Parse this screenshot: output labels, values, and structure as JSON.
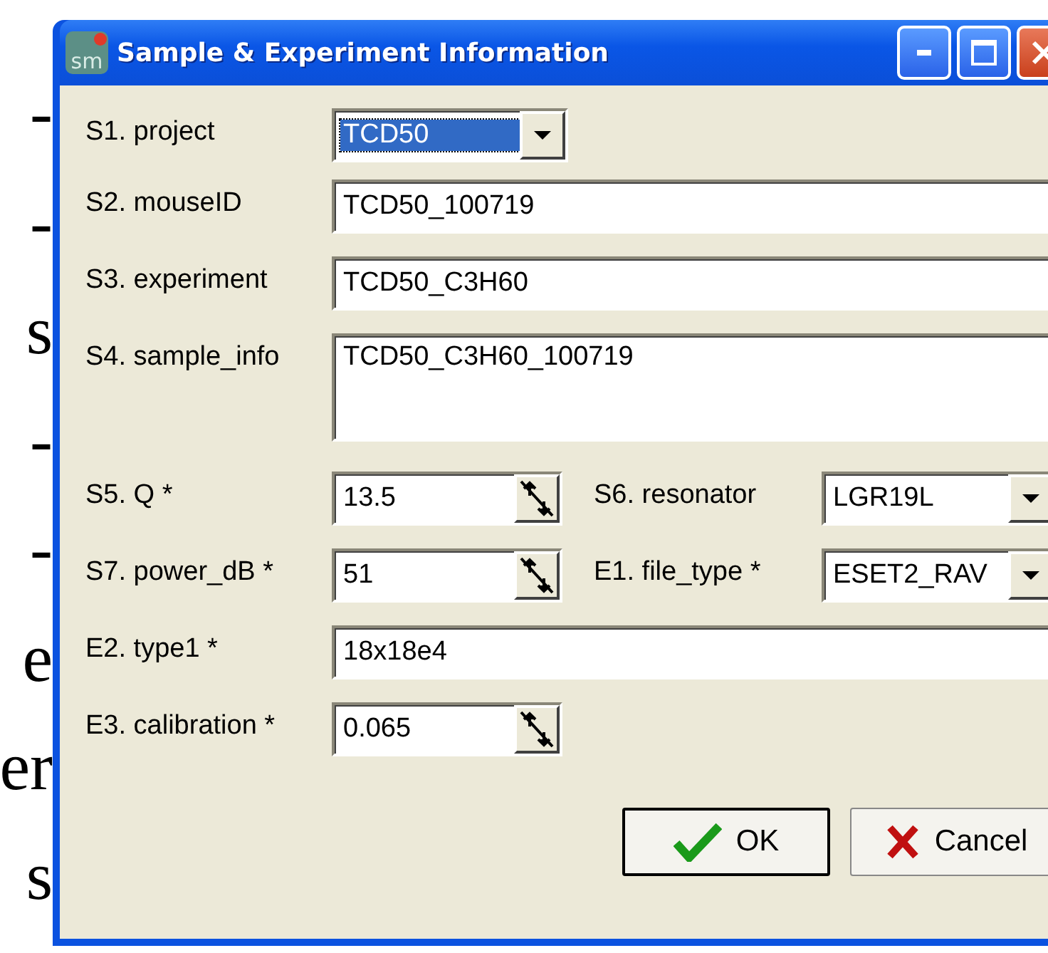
{
  "background_text": [
    "-",
    "-",
    "s",
    "-",
    "-",
    "e",
    "er",
    "s"
  ],
  "window": {
    "icon_text": "sm",
    "title": "Sample & Experiment Information",
    "controls": [
      {
        "kind": "minimize"
      },
      {
        "kind": "maximize"
      },
      {
        "kind": "close"
      }
    ]
  },
  "rows": [
    {
      "fields": [
        {
          "label": "S1. project",
          "kind": "combo",
          "value": "TCD50",
          "focused": true
        }
      ]
    },
    {
      "fields": [
        {
          "label": "S2. mouseID",
          "kind": "text",
          "value": "TCD50_100719",
          "focused": false
        }
      ]
    },
    {
      "fields": [
        {
          "label": "S3. experiment",
          "kind": "text",
          "value": "TCD50_C3H60",
          "focused": false
        }
      ]
    },
    {
      "fields": [
        {
          "label": "S4. sample_info",
          "kind": "textarea",
          "value": "TCD50_C3H60_100719",
          "focused": false
        }
      ]
    },
    {
      "fields": [
        {
          "label": "S5. Q *",
          "kind": "spin",
          "value": "13.5",
          "focused": false
        },
        {
          "label": "S6. resonator",
          "kind": "combo",
          "value": "LGR19L",
          "focused": false
        }
      ]
    },
    {
      "fields": [
        {
          "label": "S7. power_dB *",
          "kind": "spin",
          "value": "51",
          "focused": false
        },
        {
          "label": "E1. file_type *",
          "kind": "combo",
          "value": "ESET2_RAV",
          "focused": false
        }
      ]
    },
    {
      "fields": [
        {
          "label": "E2. type1 *",
          "kind": "text",
          "value": "18x18e4",
          "focused": false
        }
      ]
    },
    {
      "fields": [
        {
          "label": "E3. calibration *",
          "kind": "spin",
          "value": "0.065",
          "focused": false
        }
      ]
    }
  ],
  "buttons": [
    {
      "kind": "ok",
      "label": "OK"
    },
    {
      "kind": "cancel",
      "label": "Cancel"
    }
  ]
}
